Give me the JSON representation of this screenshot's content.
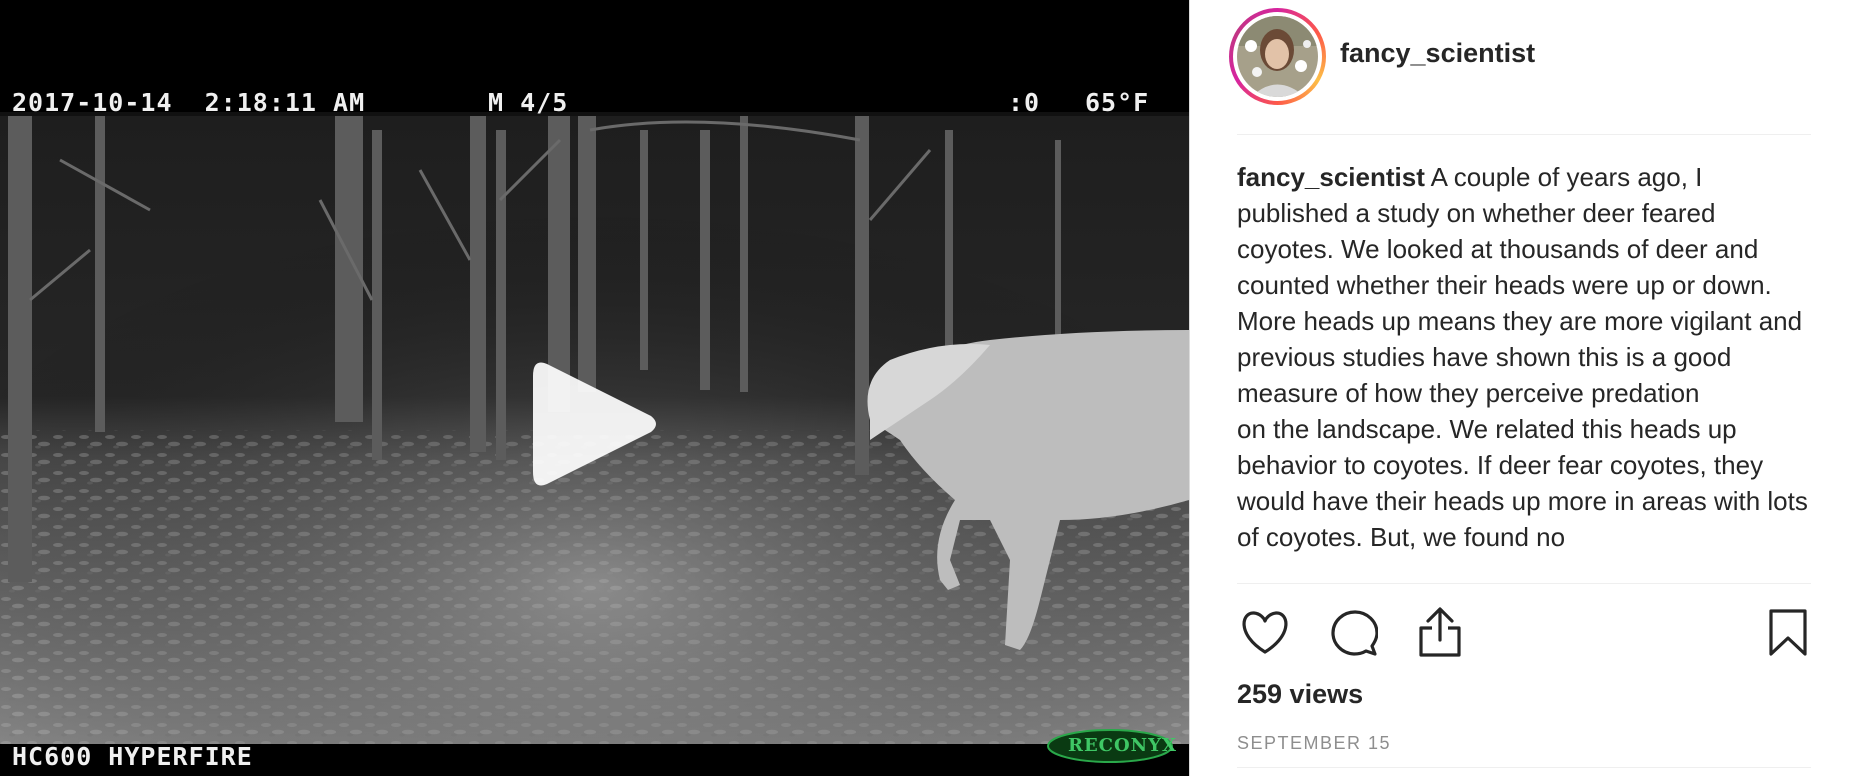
{
  "video": {
    "osd_timestamp": "2017-10-14  2:18:11 AM",
    "osd_frame": "M 4/5",
    "osd_moon": ":0",
    "osd_temp": "65°F",
    "osd_model": "HC600 HYPERFIRE",
    "osd_brand": "RECONYX",
    "play_icon": "play-icon"
  },
  "post": {
    "author": "fancy_scientist",
    "caption_user": "fancy_scientist",
    "caption_lines": [
      " A couple of years ago, I published a study on whether deer feared coyotes. We looked at thousands of deer and counted whether their heads were up or down. More heads up means they are more vigilant and previous studies have shown this is a good measure of how they perceive predation",
      "on the landscape. We related this heads up behavior to coyotes. If deer fear coyotes, they would have their heads up more in areas with lots of coyotes. But, we found no"
    ],
    "views": "259 views",
    "date": "SEPTEMBER 15",
    "accent_ring": [
      "#d6249f",
      "#fd5949",
      "#fdbf47"
    ]
  },
  "actions": {
    "like_icon": "heart-icon",
    "comment_icon": "comment-icon",
    "share_icon": "share-icon",
    "save_icon": "bookmark-icon"
  }
}
